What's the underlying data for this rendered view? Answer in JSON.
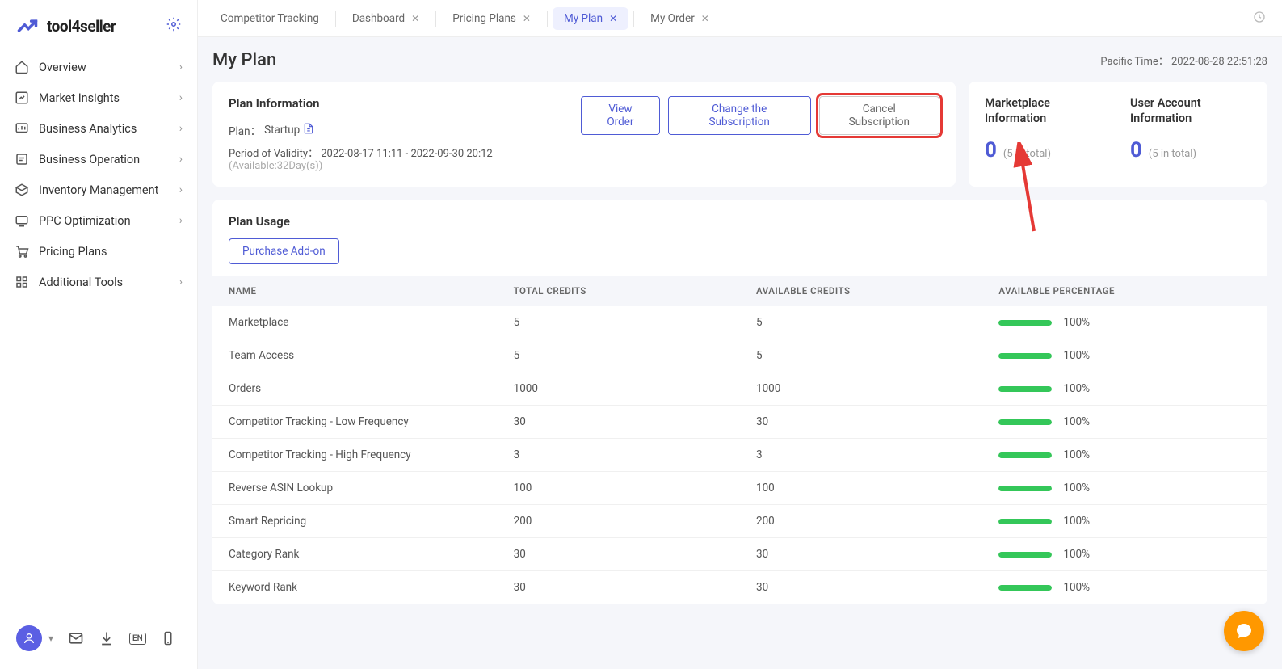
{
  "logo_text": "tool4seller",
  "sidebar": {
    "items": [
      {
        "label": "Overview",
        "icon": "home",
        "chevron": true
      },
      {
        "label": "Market Insights",
        "icon": "insight",
        "chevron": true
      },
      {
        "label": "Business Analytics",
        "icon": "analytics",
        "chevron": true
      },
      {
        "label": "Business Operation",
        "icon": "operation",
        "chevron": true
      },
      {
        "label": "Inventory Management",
        "icon": "inventory",
        "chevron": true
      },
      {
        "label": "PPC Optimization",
        "icon": "ppc",
        "chevron": true
      },
      {
        "label": "Pricing Plans",
        "icon": "cart",
        "chevron": false
      },
      {
        "label": "Additional Tools",
        "icon": "tools",
        "chevron": true
      }
    ]
  },
  "tabs": [
    {
      "label": "Competitor Tracking",
      "closable": false,
      "active": false
    },
    {
      "label": "Dashboard",
      "closable": true,
      "active": false
    },
    {
      "label": "Pricing Plans",
      "closable": true,
      "active": false
    },
    {
      "label": "My Plan",
      "closable": true,
      "active": true
    },
    {
      "label": "My Order",
      "closable": true,
      "active": false
    }
  ],
  "page": {
    "title": "My Plan",
    "tz_label": "Pacific Time：",
    "tz_value": "2022-08-28 22:51:28"
  },
  "plan_info": {
    "heading": "Plan Information",
    "plan_label": "Plan：",
    "plan_value": "Startup",
    "period_label": "Period of Validity：",
    "period_value": "2022-08-17 11:11 - 2022-09-30 20:12",
    "available_text": "(Available:32Day(s))",
    "buttons": {
      "view_order": "View Order",
      "change_sub": "Change the Subscription",
      "cancel_sub": "Cancel Subscription"
    }
  },
  "marketplace_info": {
    "heading": "Marketplace Information",
    "value": "0",
    "sub": "(5 in total)"
  },
  "account_info": {
    "heading": "User Account Information",
    "value": "0",
    "sub": "(5 in total)"
  },
  "usage": {
    "heading": "Plan Usage",
    "purchase_btn": "Purchase Add-on",
    "columns": {
      "name": "NAME",
      "total": "TOTAL CREDITS",
      "available": "AVAILABLE CREDITS",
      "pct": "AVAILABLE PERCENTAGE"
    },
    "rows": [
      {
        "name": "Marketplace",
        "total": "5",
        "available": "5",
        "pct": "100%",
        "fill": 100
      },
      {
        "name": "Team Access",
        "total": "5",
        "available": "5",
        "pct": "100%",
        "fill": 100
      },
      {
        "name": "Orders",
        "total": "1000",
        "available": "1000",
        "pct": "100%",
        "fill": 100
      },
      {
        "name": "Competitor Tracking - Low Frequency",
        "total": "30",
        "available": "30",
        "pct": "100%",
        "fill": 100
      },
      {
        "name": "Competitor Tracking - High Frequency",
        "total": "3",
        "available": "3",
        "pct": "100%",
        "fill": 100
      },
      {
        "name": "Reverse ASIN Lookup",
        "total": "100",
        "available": "100",
        "pct": "100%",
        "fill": 100
      },
      {
        "name": "Smart Repricing",
        "total": "200",
        "available": "200",
        "pct": "100%",
        "fill": 100
      },
      {
        "name": "Category Rank",
        "total": "30",
        "available": "30",
        "pct": "100%",
        "fill": 100
      },
      {
        "name": "Keyword Rank",
        "total": "30",
        "available": "30",
        "pct": "100%",
        "fill": 100
      }
    ]
  }
}
